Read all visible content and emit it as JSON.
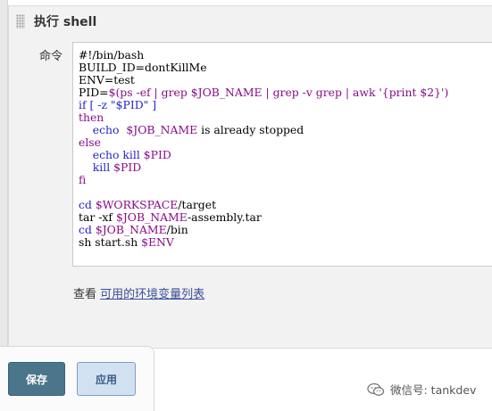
{
  "section": {
    "title": "执行 shell"
  },
  "command": {
    "label": "命令",
    "lines": [
      [
        {
          "t": "#!/bin/bash",
          "c": "black"
        }
      ],
      [
        {
          "t": "BUILD_ID=dontKillMe",
          "c": "black"
        }
      ],
      [
        {
          "t": "ENV=test",
          "c": "black"
        }
      ],
      [
        {
          "t": "PID=",
          "c": "black"
        },
        {
          "t": "$(ps -ef | grep $JOB_NAME | grep -v grep | awk '{print $2}')",
          "c": "purple"
        }
      ],
      [
        {
          "t": "if [ -z \"$PID\" ]",
          "c": "blue"
        }
      ],
      [
        {
          "t": "then",
          "c": "purple"
        }
      ],
      [
        {
          "t": "    echo  ",
          "c": "blue"
        },
        {
          "t": "$JOB_NAME",
          "c": "purple"
        },
        {
          "t": " is already stopped",
          "c": "black"
        }
      ],
      [
        {
          "t": "else",
          "c": "purple"
        }
      ],
      [
        {
          "t": "    echo kill ",
          "c": "blue"
        },
        {
          "t": "$PID",
          "c": "purple"
        }
      ],
      [
        {
          "t": "    kill ",
          "c": "blue"
        },
        {
          "t": "$PID",
          "c": "purple"
        }
      ],
      [
        {
          "t": "fi",
          "c": "purple"
        }
      ],
      [
        {
          "t": "",
          "c": "black"
        }
      ],
      [
        {
          "t": "cd ",
          "c": "blue"
        },
        {
          "t": "$WORKSPACE",
          "c": "purple"
        },
        {
          "t": "/target",
          "c": "black"
        }
      ],
      [
        {
          "t": "tar -xf ",
          "c": "black"
        },
        {
          "t": "$JOB_NAME",
          "c": "purple"
        },
        {
          "t": "-assembly.tar",
          "c": "black"
        }
      ],
      [
        {
          "t": "cd ",
          "c": "blue"
        },
        {
          "t": "$JOB_NAME",
          "c": "purple"
        },
        {
          "t": "/bin",
          "c": "black"
        }
      ],
      [
        {
          "t": "sh start.sh ",
          "c": "black"
        },
        {
          "t": "$ENV",
          "c": "purple"
        }
      ]
    ]
  },
  "env_note": {
    "prefix": "查看 ",
    "link": "可用的环境变量列表"
  },
  "buttons": {
    "save": "保存",
    "apply": "应用"
  },
  "watermark": {
    "text": "微信号: tankdev",
    "icon": "wechat-icon"
  }
}
